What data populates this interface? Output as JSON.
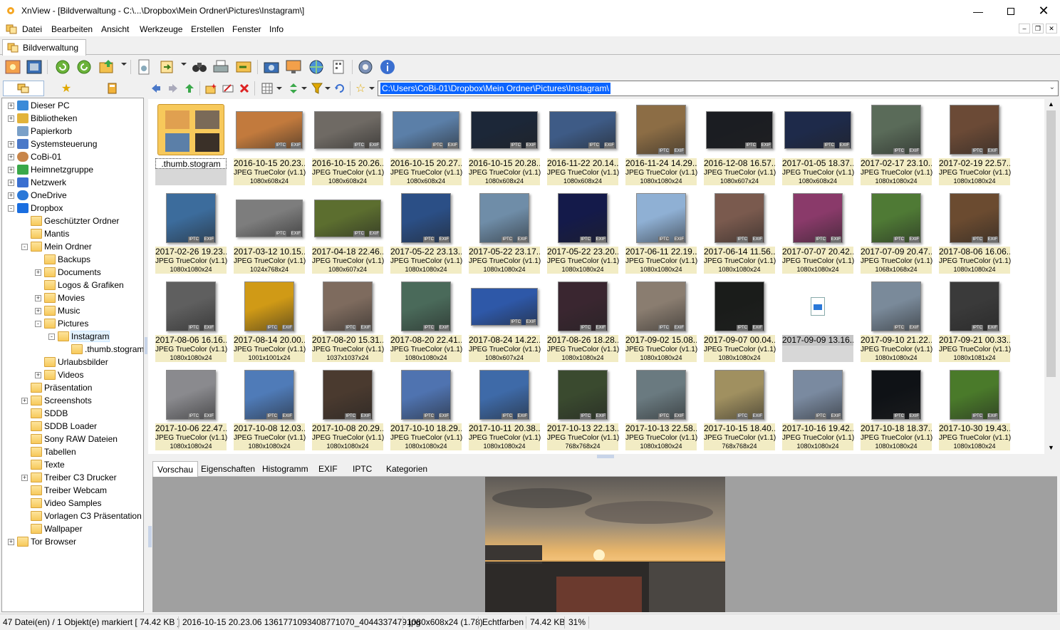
{
  "window": {
    "title": "XnView - [Bildverwaltung - C:\\...\\Dropbox\\Mein Ordner\\Pictures\\Instagram\\]",
    "min_icon": "minimize-icon",
    "max_icon": "maximize-icon",
    "close_icon": "close-icon"
  },
  "menu": [
    "Datei",
    "Bearbeiten",
    "Ansicht",
    "Werkzeuge",
    "Erstellen",
    "Fenster",
    "Info"
  ],
  "doc_tab": "Bildverwaltung",
  "path": "C:\\Users\\CoBi-01\\Dropbox\\Mein Ordner\\Pictures\\Instagram\\",
  "tree": [
    {
      "label": "Dieser PC",
      "level": 0,
      "exp": "+",
      "icon": "pc"
    },
    {
      "label": "Bibliotheken",
      "level": 0,
      "exp": "+",
      "icon": "lib"
    },
    {
      "label": "Papierkorb",
      "level": 0,
      "exp": "",
      "icon": "bin"
    },
    {
      "label": "Systemsteuerung",
      "level": 0,
      "exp": "+",
      "icon": "ctrl"
    },
    {
      "label": "CoBi-01",
      "level": 0,
      "exp": "+",
      "icon": "user"
    },
    {
      "label": "Heimnetzgruppe",
      "level": 0,
      "exp": "+",
      "icon": "home"
    },
    {
      "label": "Netzwerk",
      "level": 0,
      "exp": "+",
      "icon": "net"
    },
    {
      "label": "OneDrive",
      "level": 0,
      "exp": "+",
      "icon": "cloud"
    },
    {
      "label": "Dropbox",
      "level": 0,
      "exp": "-",
      "icon": "dropbox"
    },
    {
      "label": "Geschützter Ordner",
      "level": 1,
      "exp": "",
      "icon": "folder"
    },
    {
      "label": "Mantis",
      "level": 1,
      "exp": "",
      "icon": "folder"
    },
    {
      "label": "Mein Ordner",
      "level": 1,
      "exp": "-",
      "icon": "folder"
    },
    {
      "label": "Backups",
      "level": 2,
      "exp": "",
      "icon": "folder"
    },
    {
      "label": "Documents",
      "level": 2,
      "exp": "+",
      "icon": "folder"
    },
    {
      "label": "Logos & Grafiken",
      "level": 2,
      "exp": "",
      "icon": "folder"
    },
    {
      "label": "Movies",
      "level": 2,
      "exp": "+",
      "icon": "folder"
    },
    {
      "label": "Music",
      "level": 2,
      "exp": "+",
      "icon": "folder"
    },
    {
      "label": "Pictures",
      "level": 2,
      "exp": "-",
      "icon": "folder"
    },
    {
      "label": "Instagram",
      "level": 3,
      "exp": "-",
      "icon": "folder",
      "selected": true
    },
    {
      "label": ".thumb.stogram",
      "level": 4,
      "exp": "",
      "icon": "folder"
    },
    {
      "label": "Urlaubsbilder",
      "level": 2,
      "exp": "",
      "icon": "folder"
    },
    {
      "label": "Videos",
      "level": 2,
      "exp": "+",
      "icon": "folder"
    },
    {
      "label": "Präsentation",
      "level": 1,
      "exp": "",
      "icon": "folder"
    },
    {
      "label": "Screenshots",
      "level": 1,
      "exp": "+",
      "icon": "folder"
    },
    {
      "label": "SDDB",
      "level": 1,
      "exp": "",
      "icon": "folder"
    },
    {
      "label": "SDDB Loader",
      "level": 1,
      "exp": "",
      "icon": "folder"
    },
    {
      "label": "Sony RAW Dateien",
      "level": 1,
      "exp": "",
      "icon": "folder"
    },
    {
      "label": "Tabellen",
      "level": 1,
      "exp": "",
      "icon": "folder"
    },
    {
      "label": "Texte",
      "level": 1,
      "exp": "",
      "icon": "folder"
    },
    {
      "label": "Treiber C3 Drucker",
      "level": 1,
      "exp": "+",
      "icon": "folder"
    },
    {
      "label": "Treiber Webcam",
      "level": 1,
      "exp": "",
      "icon": "folder"
    },
    {
      "label": "Video Samples",
      "level": 1,
      "exp": "",
      "icon": "folder"
    },
    {
      "label": "Vorlagen C3 Präsentation",
      "level": 1,
      "exp": "",
      "icon": "folder"
    },
    {
      "label": "Wallpaper",
      "level": 1,
      "exp": "",
      "icon": "folder"
    },
    {
      "label": "Tor Browser",
      "level": 0,
      "exp": "+",
      "icon": "folder"
    }
  ],
  "files": [
    {
      "name": ".thumb.stogram",
      "type": "",
      "dim": "",
      "kind": "folder"
    },
    {
      "name": "2016-10-15 20.23...",
      "type": "JPEG TrueColor (v1.1)",
      "dim": "1080x608x24",
      "shape": "w",
      "color": "#c27a3d",
      "selected": true
    },
    {
      "name": "2016-10-15 20.26...",
      "type": "JPEG TrueColor (v1.1)",
      "dim": "1080x608x24",
      "shape": "w",
      "color": "#6f6a64"
    },
    {
      "name": "2016-10-15 20.27...",
      "type": "JPEG TrueColor (v1.1)",
      "dim": "1080x608x24",
      "shape": "w",
      "color": "#5b7fa8"
    },
    {
      "name": "2016-10-15 20.28...",
      "type": "JPEG TrueColor (v1.1)",
      "dim": "1080x608x24",
      "shape": "w",
      "color": "#1c2738"
    },
    {
      "name": "2016-11-22 20.14...",
      "type": "JPEG TrueColor (v1.1)",
      "dim": "1080x608x24",
      "shape": "w",
      "color": "#3e5b86"
    },
    {
      "name": "2016-11-24 14.29...",
      "type": "JPEG TrueColor (v1.1)",
      "dim": "1080x1080x24",
      "shape": "s",
      "color": "#8c6d45"
    },
    {
      "name": "2016-12-08 16.57...",
      "type": "JPEG TrueColor (v1.1)",
      "dim": "1080x607x24",
      "shape": "w",
      "color": "#1b1d22"
    },
    {
      "name": "2017-01-05 18.37...",
      "type": "JPEG TrueColor (v1.1)",
      "dim": "1080x608x24",
      "shape": "w",
      "color": "#1e2a4a"
    },
    {
      "name": "2017-02-17 23.10...",
      "type": "JPEG TrueColor (v1.1)",
      "dim": "1080x1080x24",
      "shape": "s",
      "color": "#5a6b59"
    },
    {
      "name": "2017-02-19 22.57...",
      "type": "JPEG TrueColor (v1.1)",
      "dim": "1080x1080x24",
      "shape": "s",
      "color": "#6b4a36"
    },
    {
      "name": "2017-02-26 19.23...",
      "type": "JPEG TrueColor (v1.1)",
      "dim": "1080x1080x24",
      "shape": "s",
      "color": "#3c6c9c"
    },
    {
      "name": "2017-03-12 10.15...",
      "type": "JPEG TrueColor (v1.1)",
      "dim": "1024x768x24",
      "shape": "w",
      "color": "#7d7d7d"
    },
    {
      "name": "2017-04-18 22.46...",
      "type": "JPEG TrueColor (v1.1)",
      "dim": "1080x607x24",
      "shape": "w",
      "color": "#5c6e2f"
    },
    {
      "name": "2017-05-22 23.13...",
      "type": "JPEG TrueColor (v1.1)",
      "dim": "1080x1080x24",
      "shape": "s",
      "color": "#2b4f86"
    },
    {
      "name": "2017-05-22 23.17...",
      "type": "JPEG TrueColor (v1.1)",
      "dim": "1080x1080x24",
      "shape": "s",
      "color": "#6f8da8"
    },
    {
      "name": "2017-05-22 23.20...",
      "type": "JPEG TrueColor (v1.1)",
      "dim": "1080x1080x24",
      "shape": "s",
      "color": "#141a4a"
    },
    {
      "name": "2017-06-11 22.19...",
      "type": "JPEG TrueColor (v1.1)",
      "dim": "1080x1080x24",
      "shape": "s",
      "color": "#8fb0d4"
    },
    {
      "name": "2017-06-14 11.56...",
      "type": "JPEG TrueColor (v1.1)",
      "dim": "1080x1080x24",
      "shape": "s",
      "color": "#7a5a4e"
    },
    {
      "name": "2017-07-07 20.42...",
      "type": "JPEG TrueColor (v1.1)",
      "dim": "1080x1080x24",
      "shape": "s",
      "color": "#8a3a6a"
    },
    {
      "name": "2017-07-09 20.47...",
      "type": "JPEG TrueColor (v1.1)",
      "dim": "1068x1068x24",
      "shape": "s",
      "color": "#4f7a35"
    },
    {
      "name": "2017-08-06 16.06...",
      "type": "JPEG TrueColor (v1.1)",
      "dim": "1080x1080x24",
      "shape": "s",
      "color": "#6b4b30"
    },
    {
      "name": "2017-08-06 16.16...",
      "type": "JPEG TrueColor (v1.1)",
      "dim": "1080x1080x24",
      "shape": "s",
      "color": "#5f5f5f"
    },
    {
      "name": "2017-08-14 20.00...",
      "type": "JPEG TrueColor (v1.1)",
      "dim": "1001x1001x24",
      "shape": "s",
      "color": "#d09a16"
    },
    {
      "name": "2017-08-20 15.31...",
      "type": "JPEG TrueColor (v1.1)",
      "dim": "1037x1037x24",
      "shape": "s",
      "color": "#7e6b5e"
    },
    {
      "name": "2017-08-20 22.41...",
      "type": "JPEG TrueColor (v1.1)",
      "dim": "1080x1080x24",
      "shape": "s",
      "color": "#4a6a5a"
    },
    {
      "name": "2017-08-24 14.22...",
      "type": "JPEG TrueColor (v1.1)",
      "dim": "1080x607x24",
      "shape": "w",
      "color": "#2e58a8"
    },
    {
      "name": "2017-08-26 18.28...",
      "type": "JPEG TrueColor (v1.1)",
      "dim": "1080x1080x24",
      "shape": "s",
      "color": "#3a2630"
    },
    {
      "name": "2017-09-02 15.08...",
      "type": "JPEG TrueColor (v1.1)",
      "dim": "1080x1080x24",
      "shape": "s",
      "color": "#8a7d70"
    },
    {
      "name": "2017-09-07 00.04...",
      "type": "JPEG TrueColor (v1.1)",
      "dim": "1080x1080x24",
      "shape": "s",
      "color": "#1a1c1a"
    },
    {
      "name": "2017-09-09 13.16...",
      "type": "",
      "dim": "",
      "kind": "video"
    },
    {
      "name": "2017-09-10 21.22...",
      "type": "JPEG TrueColor (v1.1)",
      "dim": "1080x1080x24",
      "shape": "s",
      "color": "#7a8a9a"
    },
    {
      "name": "2017-09-21 00.33...",
      "type": "JPEG TrueColor (v1.1)",
      "dim": "1080x1081x24",
      "shape": "s",
      "color": "#3a3a3a"
    },
    {
      "name": "2017-10-06 22.47...",
      "type": "JPEG TrueColor (v1.1)",
      "dim": "1080x1080x24",
      "shape": "s",
      "color": "#8a8a8e"
    },
    {
      "name": "2017-10-08 12.03...",
      "type": "JPEG TrueColor (v1.1)",
      "dim": "1080x1080x24",
      "shape": "s",
      "color": "#4f7bb8"
    },
    {
      "name": "2017-10-08 20.29...",
      "type": "JPEG TrueColor (v1.1)",
      "dim": "1080x1080x24",
      "shape": "s",
      "color": "#4a3a2f"
    },
    {
      "name": "2017-10-10 18.29...",
      "type": "JPEG TrueColor (v1.1)",
      "dim": "1080x1080x24",
      "shape": "s",
      "color": "#4f73b0"
    },
    {
      "name": "2017-10-11 20.38...",
      "type": "JPEG TrueColor (v1.1)",
      "dim": "1080x1080x24",
      "shape": "s",
      "color": "#3e6aa8"
    },
    {
      "name": "2017-10-13 22.13...",
      "type": "JPEG TrueColor (v1.1)",
      "dim": "768x768x24",
      "shape": "s",
      "color": "#3a4a2f"
    },
    {
      "name": "2017-10-13 22.58...",
      "type": "JPEG TrueColor (v1.1)",
      "dim": "1080x1080x24",
      "shape": "s",
      "color": "#6a7a80"
    },
    {
      "name": "2017-10-15 18.40...",
      "type": "JPEG TrueColor (v1.1)",
      "dim": "768x768x24",
      "shape": "s",
      "color": "#a09060"
    },
    {
      "name": "2017-10-16 19.42...",
      "type": "JPEG TrueColor (v1.1)",
      "dim": "1080x1080x24",
      "shape": "s",
      "color": "#7a8aa0"
    },
    {
      "name": "2017-10-18 18.37...",
      "type": "JPEG TrueColor (v1.1)",
      "dim": "1080x1080x24",
      "shape": "s",
      "color": "#0f1216"
    },
    {
      "name": "2017-10-30 19.43...",
      "type": "JPEG TrueColor (v1.1)",
      "dim": "1080x1080x24",
      "shape": "s",
      "color": "#4a7a2a"
    }
  ],
  "badges": {
    "iptc": "IPTC",
    "exif": "EXIF"
  },
  "bottom_tabs": [
    "Vorschau",
    "Eigenschaften",
    "Histogramm",
    "EXIF",
    "IPTC",
    "Kategorien"
  ],
  "status": {
    "count": "47 Datei(en) / 1 Objekt(e) markiert  [ 74.42 KB ]",
    "filename": "2016-10-15 20.23.06 1361771093408771070_4044337479.jpg",
    "dims": "1080x608x24 (1.78)",
    "color": "Echtfarben",
    "size": "74.42 KB",
    "zoom": "31%"
  }
}
